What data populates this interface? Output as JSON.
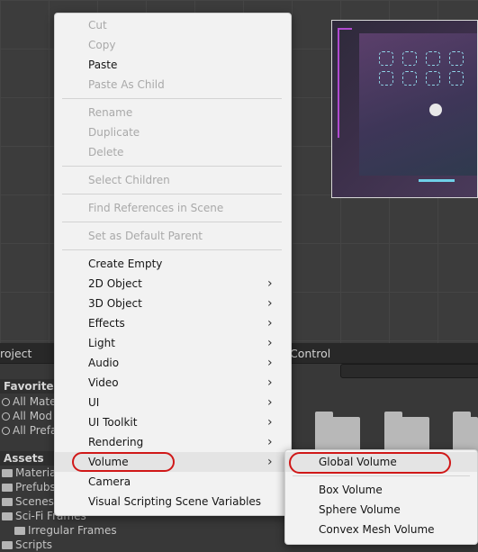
{
  "bottom_panel": {
    "tabs": [
      {
        "label": "roject"
      },
      {
        "label": "Control"
      }
    ],
    "favorites": {
      "header": "Favorites",
      "items": [
        {
          "label": "All Mate"
        },
        {
          "label": "All Mod"
        },
        {
          "label": "All Prefa"
        }
      ]
    },
    "assets": {
      "header": "Assets",
      "items": [
        {
          "label": "Materia"
        },
        {
          "label": "Prefubs"
        },
        {
          "label": "Scenes"
        },
        {
          "label": "Sci-Fi Frames"
        },
        {
          "label": "Irregular Frames"
        },
        {
          "label": "Scripts"
        }
      ]
    }
  },
  "context_menu": {
    "items": [
      {
        "label": "Cut",
        "enabled": false
      },
      {
        "label": "Copy",
        "enabled": false
      },
      {
        "label": "Paste",
        "enabled": true
      },
      {
        "label": "Paste As Child",
        "enabled": false
      },
      {
        "label": "Rename",
        "enabled": false
      },
      {
        "label": "Duplicate",
        "enabled": false
      },
      {
        "label": "Delete",
        "enabled": false
      },
      {
        "label": "Select Children",
        "enabled": false
      },
      {
        "label": "Find References in Scene",
        "enabled": false
      },
      {
        "label": "Set as Default Parent",
        "enabled": false
      },
      {
        "label": "Create Empty",
        "enabled": true
      },
      {
        "label": "2D Object",
        "enabled": true,
        "submenu": true
      },
      {
        "label": "3D Object",
        "enabled": true,
        "submenu": true
      },
      {
        "label": "Effects",
        "enabled": true,
        "submenu": true
      },
      {
        "label": "Light",
        "enabled": true,
        "submenu": true
      },
      {
        "label": "Audio",
        "enabled": true,
        "submenu": true
      },
      {
        "label": "Video",
        "enabled": true,
        "submenu": true
      },
      {
        "label": "UI",
        "enabled": true,
        "submenu": true
      },
      {
        "label": "UI Toolkit",
        "enabled": true,
        "submenu": true
      },
      {
        "label": "Rendering",
        "enabled": true,
        "submenu": true
      },
      {
        "label": "Volume",
        "enabled": true,
        "submenu": true,
        "highlighted": true
      },
      {
        "label": "Camera",
        "enabled": true
      },
      {
        "label": "Visual Scripting Scene Variables",
        "enabled": true
      }
    ]
  },
  "volume_submenu": {
    "items": [
      {
        "label": "Global Volume",
        "highlighted": true
      },
      {
        "label": "Box Volume"
      },
      {
        "label": "Sphere Volume"
      },
      {
        "label": "Convex Mesh Volume"
      }
    ]
  },
  "submenu_arrow_glyph": "›",
  "annotation_color": "#d01818"
}
